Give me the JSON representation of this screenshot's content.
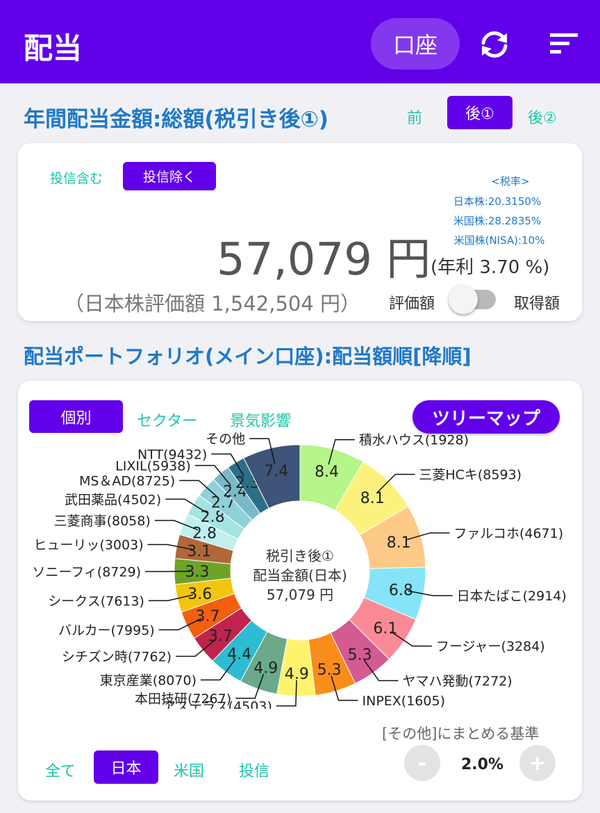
{
  "header": {
    "title": "配当",
    "account_label": "口座"
  },
  "summary": {
    "title": "年間配当金額:総額(税引き後①)",
    "tax_tabs": [
      "前",
      "後①",
      "後②"
    ],
    "fund_tabs": [
      "投信含む",
      "投信除く"
    ],
    "tax_rate": {
      "heading": "<税率>",
      "jp": "日本株:20.3150%",
      "us": "米国株:28.2835%",
      "us_nisa": "米国株(NISA):10%"
    },
    "amount": "57,079 円",
    "yield": "(年利 3.70 %)",
    "jp_eval": "（日本株評価額 1,542,504 円）",
    "switch_left": "評価額",
    "switch_right": "取得額"
  },
  "portfolio": {
    "title": "配当ポートフォリオ(メイン口座):配当額順[降順]",
    "view_tabs": [
      "個別",
      "セクター",
      "景気影響"
    ],
    "treemap_label": "ツリーマップ",
    "center": [
      "税引き後①",
      "配当金額(日本)",
      "57,079 円"
    ],
    "market_tabs": [
      "全て",
      "日本",
      "米国",
      "投信"
    ],
    "other_criteria_label": "[その他]にまとめる基準",
    "minus_label": "-",
    "plus_label": "+",
    "other_pct": "2.0%"
  },
  "chart_data": {
    "type": "pie",
    "labels": [
      "積水ハウス(1928)",
      "三菱HCキ(8593)",
      "ファルコホ(4671)",
      "日本たばこ(2914)",
      "フージャー(3284)",
      "ヤマハ発動(7272)",
      "INPEX(1605)",
      "アステラス(4503)",
      "本田技研(7267)",
      "東京産業(8070)",
      "シチズン時(7762)",
      "バルカー(7995)",
      "シークス(7613)",
      "ソニーフィ(8729)",
      "ヒューリッ(3003)",
      "三菱商事(8058)",
      "武田薬品(4502)",
      "MS＆AD(8725)",
      "LIXIL(5938)",
      "NTT(9432)",
      "その他"
    ],
    "values": [
      8.4,
      8.1,
      8.1,
      6.8,
      6.1,
      5.3,
      5.3,
      4.9,
      4.9,
      4.4,
      3.7,
      3.7,
      3.6,
      3.3,
      3.1,
      2.8,
      2.8,
      2.7,
      2.4,
      2.3,
      7.4
    ],
    "value_labels": [
      "8.4",
      "8.1",
      "8.1",
      "6.8",
      "6.1",
      "5.3",
      "5.3",
      "4.9",
      "4.9",
      "4.4",
      "3.7",
      "3.7",
      "3.6",
      "3.3",
      "3.1",
      "2.8",
      "2.8",
      "2.7",
      "2.4",
      "2.3",
      "7.4"
    ],
    "colors": [
      "#b5f58a",
      "#fbf27e",
      "#fdc987",
      "#86e4f8",
      "#fb8a97",
      "#d45a92",
      "#f98d1b",
      "#fff36e",
      "#6aa989",
      "#2cbcd3",
      "#c0234d",
      "#f35f0f",
      "#f2c60d",
      "#6ea326",
      "#b0673a",
      "#bff0ee",
      "#a6e3e3",
      "#8fd1d8",
      "#79b9c8",
      "#2b6f86",
      "#3e5478"
    ]
  }
}
